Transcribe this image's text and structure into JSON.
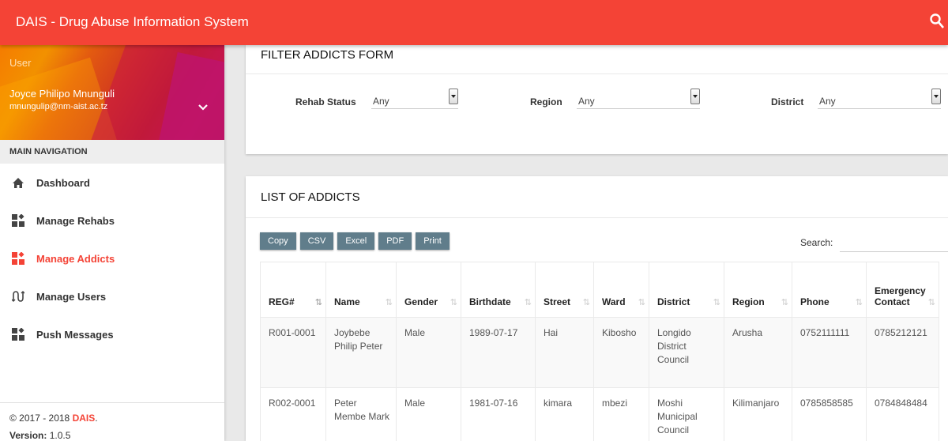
{
  "app": {
    "title": "DAIS - Drug Abuse Information System"
  },
  "user": {
    "role": "User",
    "name": "Joyce Philipo Mnunguli",
    "email": "mnungulip@nm-aist.ac.tz"
  },
  "nav": {
    "header": "MAIN NAVIGATION",
    "items": [
      {
        "label": "Dashboard",
        "icon": "home-icon"
      },
      {
        "label": "Manage Rehabs",
        "icon": "dashboard-grid-icon"
      },
      {
        "label": "Manage Addicts",
        "icon": "dashboard-grid-icon",
        "active": true
      },
      {
        "label": "Manage Users",
        "icon": "users-icon"
      },
      {
        "label": "Push Messages",
        "icon": "dashboard-grid-icon"
      }
    ]
  },
  "footer": {
    "copyright": "© 2017 - 2018 ",
    "brand": "DAIS",
    "brand_suffix": ".",
    "version_label": "Version:",
    "version_value": " 1.0.5"
  },
  "filter": {
    "title": "FILTER ADDICTS FORM",
    "fields": [
      {
        "label": "Rehab Status",
        "value": "Any"
      },
      {
        "label": "Region",
        "value": "Any"
      },
      {
        "label": "District",
        "value": "Any"
      }
    ]
  },
  "list": {
    "title": "LIST OF ADDICTS",
    "buttons": [
      "Copy",
      "CSV",
      "Excel",
      "PDF",
      "Print"
    ],
    "search_label": "Search:",
    "columns": [
      "REG#",
      "Name",
      "Gender",
      "Birthdate",
      "Street",
      "Ward",
      "District",
      "Region",
      "Phone",
      "Emergency Contact"
    ],
    "rows": [
      [
        "R001-0001",
        "Joybebe Philip Peter",
        "Male",
        "1989-07-17",
        "Hai",
        "Kibosho",
        "Longido District Council",
        "Arusha",
        "0752111111",
        "0785212121"
      ],
      [
        "R002-0001",
        "Peter Membe Mark",
        "Male",
        "1981-07-16",
        "kimara",
        "mbezi",
        "Moshi Municipal Council",
        "Kilimanjaro",
        "0785858585",
        "0784848484"
      ]
    ]
  },
  "colors": {
    "accent": "#f44336",
    "button": "#607d8b"
  }
}
